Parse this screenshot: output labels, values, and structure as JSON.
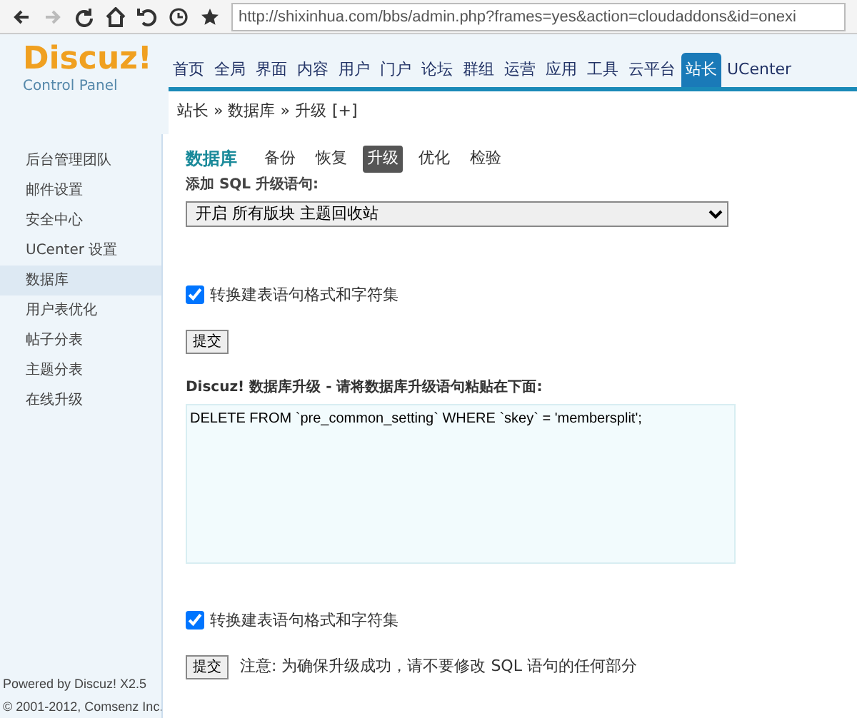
{
  "browser": {
    "url": "http://shixinhua.com/bbs/admin.php?frames=yes&action=cloudaddons&id=onexi"
  },
  "logo": {
    "title": "Discuz!",
    "subtitle": "Control Panel"
  },
  "top_nav": [
    {
      "label": "首页",
      "selected": false
    },
    {
      "label": "全局",
      "selected": false
    },
    {
      "label": "界面",
      "selected": false
    },
    {
      "label": "内容",
      "selected": false
    },
    {
      "label": "用户",
      "selected": false
    },
    {
      "label": "门户",
      "selected": false
    },
    {
      "label": "论坛",
      "selected": false
    },
    {
      "label": "群组",
      "selected": false
    },
    {
      "label": "运营",
      "selected": false
    },
    {
      "label": "应用",
      "selected": false
    },
    {
      "label": "工具",
      "selected": false
    },
    {
      "label": "云平台",
      "selected": false
    },
    {
      "label": "站长",
      "selected": true
    },
    {
      "label": "UCenter",
      "selected": false
    }
  ],
  "breadcrumb": {
    "text": "站长 » 数据库 » 升级",
    "toggle": "[+]"
  },
  "sidebar": {
    "items": [
      {
        "label": "后台管理团队",
        "selected": false
      },
      {
        "label": "邮件设置",
        "selected": false
      },
      {
        "label": "安全中心",
        "selected": false
      },
      {
        "label": "UCenter 设置",
        "selected": false
      },
      {
        "label": "数据库",
        "selected": true
      },
      {
        "label": "用户表优化",
        "selected": false
      },
      {
        "label": "帖子分表",
        "selected": false
      },
      {
        "label": "主题分表",
        "selected": false
      },
      {
        "label": "在线升级",
        "selected": false
      }
    ],
    "footer": [
      "Powered by Discuz! X2.5",
      "© 2001-2012, Comsenz Inc."
    ]
  },
  "page_title": "数据库",
  "sub_tabs": [
    {
      "label": "备份",
      "selected": false
    },
    {
      "label": "恢复",
      "selected": false
    },
    {
      "label": "升级",
      "selected": true
    },
    {
      "label": "优化",
      "selected": false
    },
    {
      "label": "检验",
      "selected": false
    }
  ],
  "upper_form": {
    "label": "添加 SQL 升级语句:",
    "select_value": "开启 所有版块 主题回收站",
    "checkbox": {
      "label": "转换建表语句格式和字符集",
      "checked": true
    },
    "submit": "提交"
  },
  "lower_form": {
    "label": "Discuz! 数据库升级 - 请将数据库升级语句粘贴在下面:",
    "sql": "DELETE FROM `pre_common_setting` WHERE `skey` = 'membersplit';",
    "checkbox": {
      "label": "转换建表语句格式和字符集",
      "checked": true
    },
    "submit": "提交",
    "note": "注意: 为确保升级成功，请不要修改 SQL 语句的任何部分"
  }
}
